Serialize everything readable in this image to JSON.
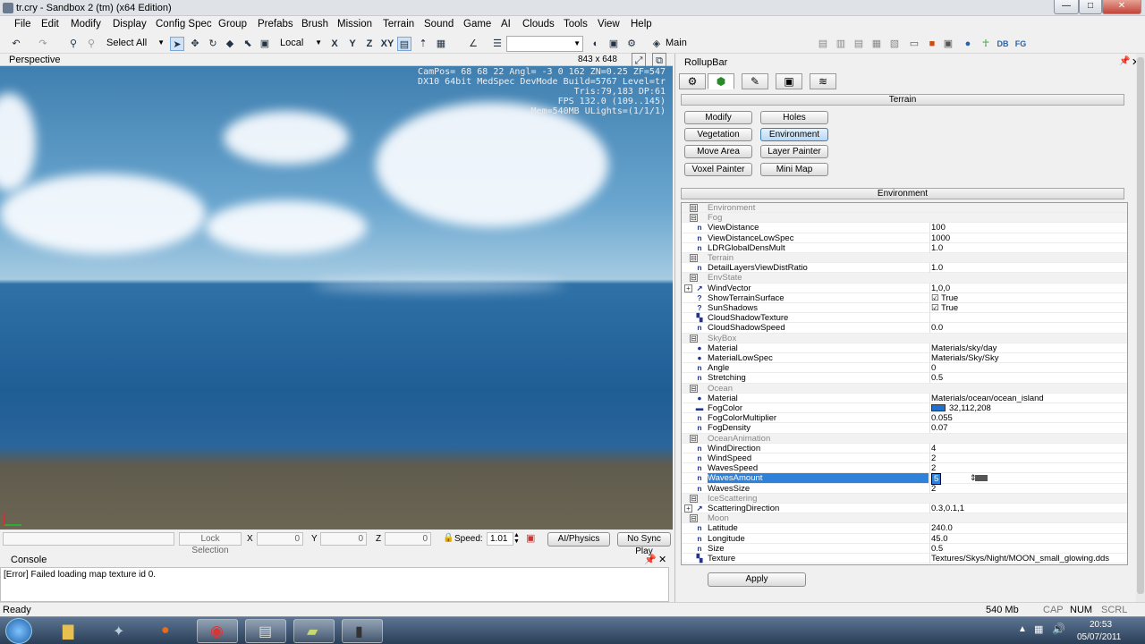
{
  "window": {
    "title": "tr.cry - Sandbox 2 (tm) (x64 Edition)",
    "min": "—",
    "max": "□",
    "close": "✕"
  },
  "menu": [
    "File",
    "Edit",
    "Modify",
    "Display",
    "Config Spec",
    "Group",
    "Prefabs",
    "Brush",
    "Mission",
    "Terrain",
    "Sound",
    "Game",
    "AI",
    "Clouds",
    "Tools",
    "View",
    "Help"
  ],
  "toolbar": {
    "select_mode": "Select All",
    "coord_system": "Local",
    "axes": [
      "X",
      "Y",
      "Z",
      "XY"
    ],
    "layout_name": "Main"
  },
  "viewport": {
    "title": "Perspective",
    "resolution": "843 x 648",
    "hud": [
      "CamPos= 68  68  22 Angl= -3  0 162 ZN=0.25 ZF=547",
      "DX10 64bit MedSpec DevMode Build=5767 Level=tr",
      "Tris:79,183  DP:61",
      "FPS 132.0 (109..145)",
      "Mem=540MB ULights=(1/1/1)"
    ]
  },
  "status_row": {
    "lock_selection": "Lock Selection",
    "x_label": "X",
    "x_value": "0",
    "y_label": "Y",
    "y_value": "0",
    "z_label": "Z",
    "z_value": "0",
    "speed_label": "Speed:",
    "speed_value": "1.01",
    "ai_physics": "AI/Physics",
    "no_sync_play": "No Sync Play"
  },
  "console": {
    "title": "Console",
    "message": "[Error] Failed loading map texture id 0."
  },
  "rollup": {
    "title": "RollupBar",
    "terrain_header": "Terrain",
    "terrain_buttons": [
      "Modify",
      "Holes",
      "Vegetation",
      "Environment",
      "Move Area",
      "Layer Painter",
      "Voxel Painter",
      "Mini Map"
    ],
    "environment_header": "Environment",
    "apply": "Apply",
    "rows": [
      {
        "kind": "grp",
        "name": "Environment",
        "exp": "⊟"
      },
      {
        "kind": "grp",
        "name": "Fog",
        "exp": "⊟"
      },
      {
        "kind": "p",
        "icon": "n",
        "name": "ViewDistance",
        "value": "100"
      },
      {
        "kind": "p",
        "icon": "n",
        "name": "ViewDistanceLowSpec",
        "value": "1000"
      },
      {
        "kind": "p",
        "icon": "n",
        "name": "LDRGlobalDensMult",
        "value": "1.0"
      },
      {
        "kind": "grp",
        "name": "Terrain",
        "exp": "⊟"
      },
      {
        "kind": "p",
        "icon": "n",
        "name": "DetailLayersViewDistRatio",
        "value": "1.0"
      },
      {
        "kind": "grp",
        "name": "EnvState",
        "exp": "⊟"
      },
      {
        "kind": "p",
        "icon": "↗",
        "name": "WindVector",
        "value": "1,0,0",
        "exp": "+"
      },
      {
        "kind": "p",
        "icon": "?",
        "name": "ShowTerrainSurface",
        "value": "☑ True"
      },
      {
        "kind": "p",
        "icon": "?",
        "name": "SunShadows",
        "value": "☑ True"
      },
      {
        "kind": "p",
        "icon": "▚",
        "name": "CloudShadowTexture",
        "value": ""
      },
      {
        "kind": "p",
        "icon": "n",
        "name": "CloudShadowSpeed",
        "value": "0.0"
      },
      {
        "kind": "grp",
        "name": "SkyBox",
        "exp": "⊟"
      },
      {
        "kind": "p",
        "icon": "●",
        "name": "Material",
        "value": "Materials/sky/day"
      },
      {
        "kind": "p",
        "icon": "●",
        "name": "MaterialLowSpec",
        "value": "Materials/Sky/Sky"
      },
      {
        "kind": "p",
        "icon": "n",
        "name": "Angle",
        "value": "0"
      },
      {
        "kind": "p",
        "icon": "n",
        "name": "Stretching",
        "value": "0.5"
      },
      {
        "kind": "grp",
        "name": "Ocean",
        "exp": "⊟"
      },
      {
        "kind": "p",
        "icon": "●",
        "name": "Material",
        "value": "Materials/ocean/ocean_island"
      },
      {
        "kind": "p",
        "icon": "▬",
        "name": "FogColor",
        "value": "32,112,208",
        "swatch": "#2070d0"
      },
      {
        "kind": "p",
        "icon": "n",
        "name": "FogColorMultiplier",
        "value": "0.055"
      },
      {
        "kind": "p",
        "icon": "n",
        "name": "FogDensity",
        "value": "0.07"
      },
      {
        "kind": "grp",
        "name": "OceanAnimation",
        "exp": "⊟"
      },
      {
        "kind": "p",
        "icon": "n",
        "name": "WindDirection",
        "value": "4"
      },
      {
        "kind": "p",
        "icon": "n",
        "name": "WindSpeed",
        "value": "2"
      },
      {
        "kind": "p",
        "icon": "n",
        "name": "WavesSpeed",
        "value": "2"
      },
      {
        "kind": "p",
        "icon": "n",
        "name": "WavesAmount",
        "value": "5",
        "selected": true
      },
      {
        "kind": "p",
        "icon": "n",
        "name": "WavesSize",
        "value": "2"
      },
      {
        "kind": "grp",
        "name": "IceScattering",
        "exp": "⊟"
      },
      {
        "kind": "p",
        "icon": "↗",
        "name": "ScatteringDirection",
        "value": "0.3,0.1,1",
        "exp": "+"
      },
      {
        "kind": "grp",
        "name": "Moon",
        "exp": "⊟"
      },
      {
        "kind": "p",
        "icon": "n",
        "name": "Latitude",
        "value": "240.0"
      },
      {
        "kind": "p",
        "icon": "n",
        "name": "Longitude",
        "value": "45.0"
      },
      {
        "kind": "p",
        "icon": "n",
        "name": "Size",
        "value": "0.5"
      },
      {
        "kind": "p",
        "icon": "▚",
        "name": "Texture",
        "value": "Textures/Skys/Night/MOON_small_glowing.dds"
      }
    ]
  },
  "statusbar": {
    "ready": "Ready",
    "mem": "540 Mb",
    "cap": "CAP",
    "num": "NUM",
    "scrl": "SCRL"
  },
  "taskbar": {
    "time": "20:53",
    "date": "05/07/2011"
  },
  "colors": {
    "selection": "#2f82d9",
    "water": "#1f5d95",
    "sky": "#6aa6cf"
  }
}
